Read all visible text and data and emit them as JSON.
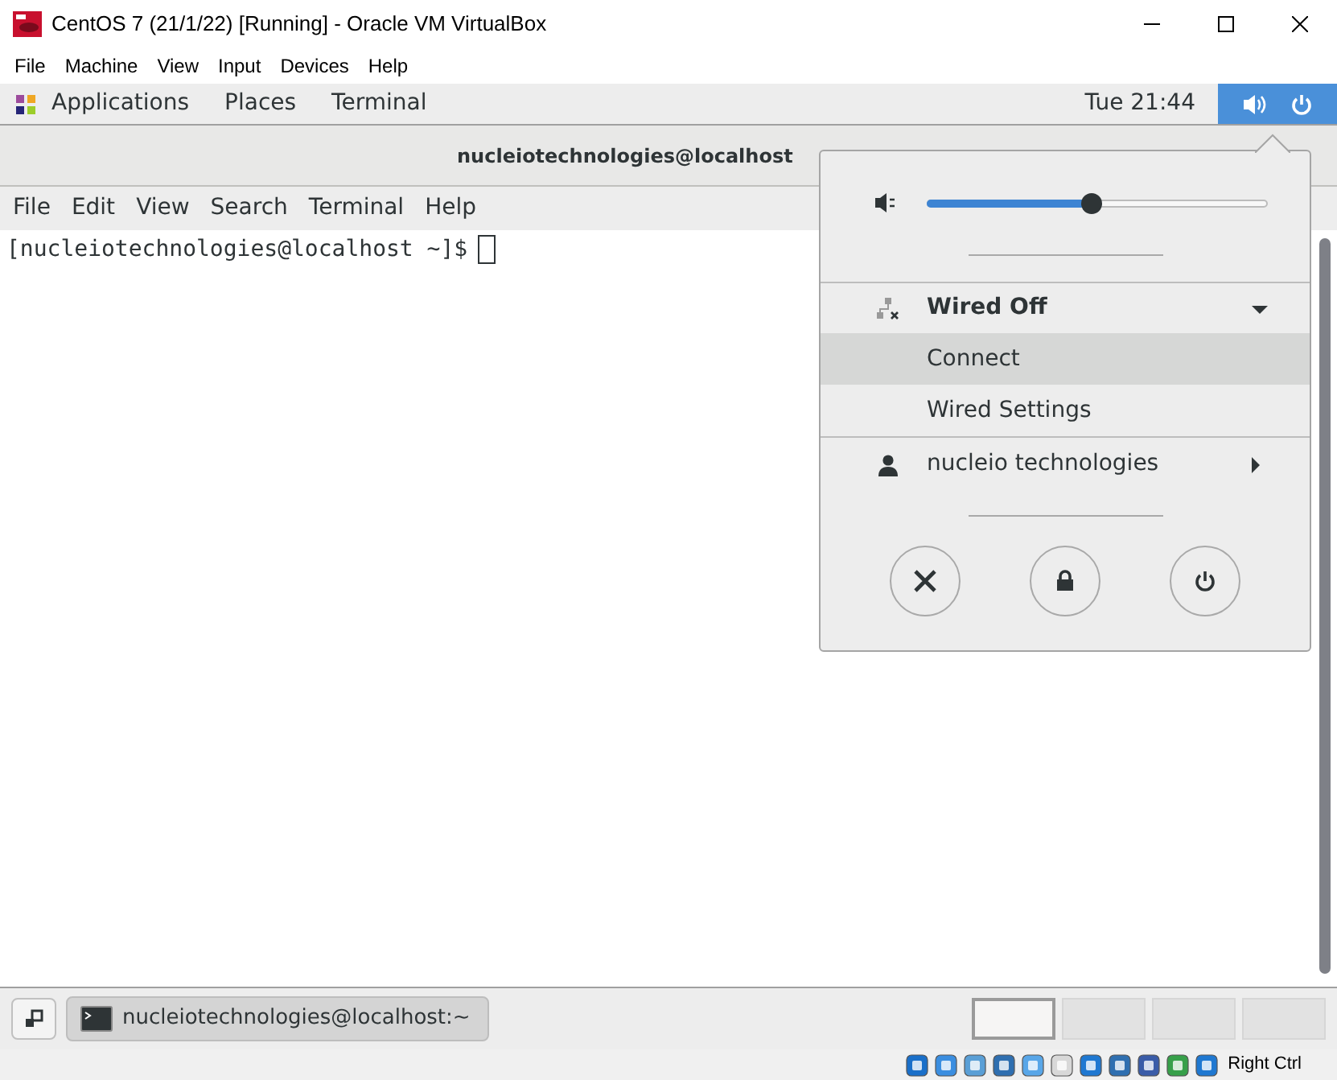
{
  "window": {
    "title": "CentOS 7 (21/1/22) [Running] - Oracle VM VirtualBox"
  },
  "vbox_menu": [
    "File",
    "Machine",
    "View",
    "Input",
    "Devices",
    "Help"
  ],
  "top_bar": {
    "items": [
      "Applications",
      "Places",
      "Terminal"
    ],
    "clock": "Tue 21:44"
  },
  "terminal": {
    "title": "nucleiotechnologies@localhost",
    "menu": [
      "File",
      "Edit",
      "View",
      "Search",
      "Terminal",
      "Help"
    ],
    "prompt": "[nucleiotechnologies@localhost ~]$"
  },
  "system_menu": {
    "volume": {
      "level": 0.48
    },
    "network": {
      "label": "Wired Off",
      "expanded": true,
      "items": [
        {
          "label": "Connect",
          "selected": true
        },
        {
          "label": "Wired Settings",
          "selected": false
        }
      ]
    },
    "user": {
      "label": "nucleio technologies"
    }
  },
  "taskbar": {
    "window_button": "nucleiotechnologies@localhost:~",
    "workspaces": [
      {
        "selected": true
      },
      {
        "selected": false
      },
      {
        "selected": false
      },
      {
        "selected": false
      }
    ]
  },
  "status_bar": {
    "host_key": "Right Ctrl"
  }
}
